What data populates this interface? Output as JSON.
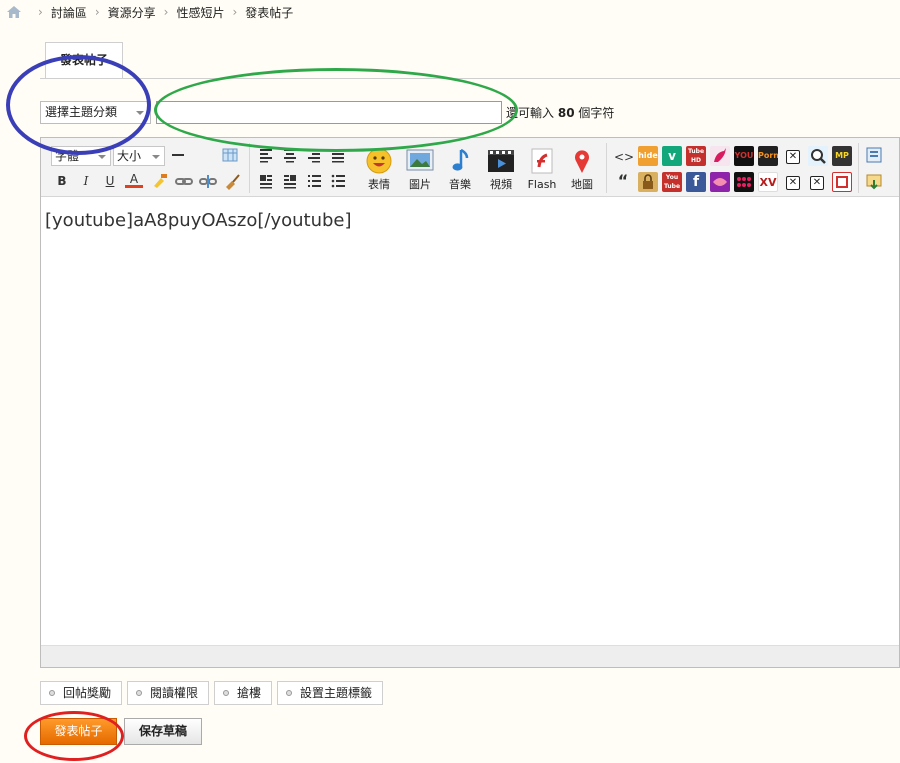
{
  "breadcrumb": {
    "items": [
      "討論區",
      "資源分享",
      "性感短片",
      "發表帖子"
    ]
  },
  "tab": {
    "label": "發表帖子"
  },
  "subject": {
    "category_label": "選擇主題分類",
    "value": "",
    "counter_prefix": "還可輸入",
    "counter_value": "80",
    "counter_suffix": "個字符"
  },
  "toolbar": {
    "font_label": "字體",
    "size_label": "大小",
    "bold": "B",
    "italic": "I",
    "underline": "U",
    "font_color": "A",
    "emoticon_label": "表情",
    "image_label": "圖片",
    "music_label": "音樂",
    "video_label": "視頻",
    "flash_label": "Flash",
    "map_label": "地圖",
    "code_glyph": "<>",
    "quote_glyph": "“",
    "tile_labels": {
      "hide": "hide",
      "tube_hd": "Tube HD",
      "ycu": "YOU",
      "porn": "Porn",
      "you_tube": "You Tube",
      "xv": "XV",
      "mp": "MP"
    }
  },
  "editor": {
    "content": "[youtube]aA8puyOAszo[/youtube]"
  },
  "options": [
    "回帖獎勵",
    "閱讀權限",
    "搶樓",
    "設置主題標籤"
  ],
  "buttons": {
    "post": "發表帖子",
    "draft": "保存草稿"
  },
  "colors": {
    "accent_orange": "#f07a10",
    "annotation_blue": "#3a3fb8",
    "annotation_green": "#2fa84a",
    "annotation_red": "#e02020"
  }
}
